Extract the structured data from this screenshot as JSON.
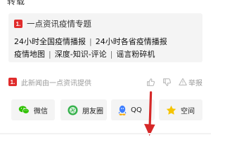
{
  "header": {
    "cut_text": "转载"
  },
  "topic": {
    "badge": "1.",
    "title": "一点资讯疫情专题",
    "row1": [
      "24小时全国疫情播报",
      "24小时各省疫情播报"
    ],
    "row2": [
      "疫情地图",
      "深度-知识-评论",
      "谣言粉碎机"
    ],
    "separator": "|"
  },
  "source": {
    "badge": "1.",
    "text": "此新闻由一点资讯提供",
    "actions": [
      {
        "icon": "thumbs-up-icon",
        "label": ""
      },
      {
        "icon": "thumbs-down-icon",
        "label": ""
      },
      {
        "icon": "warning-icon",
        "label": "举报"
      }
    ]
  },
  "share": [
    {
      "label": "微信",
      "icon": "wechat-icon",
      "color": "#2dc100"
    },
    {
      "label": "朋友圈",
      "icon": "moments-icon",
      "color": "#37b24d"
    },
    {
      "label": "QQ",
      "icon": "qq-icon",
      "color": "#3d7eff"
    },
    {
      "label": "空间",
      "icon": "qzone-icon",
      "color": "#f5c400"
    }
  ],
  "colors": {
    "accent": "#e02c2c",
    "annotation_arrow": "#d62828"
  }
}
